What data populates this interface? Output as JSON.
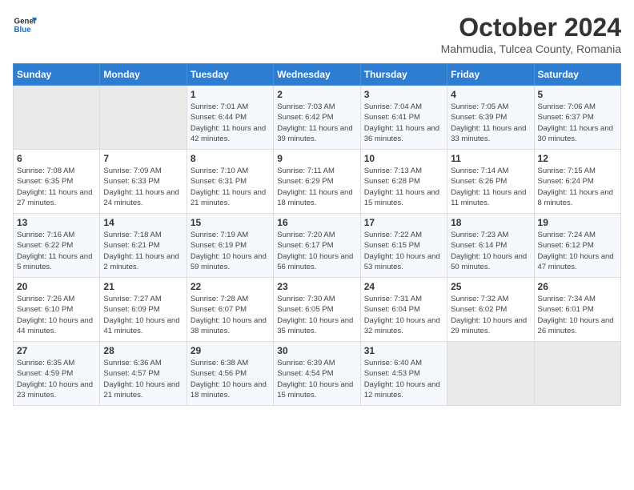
{
  "header": {
    "logo_line1": "General",
    "logo_line2": "Blue",
    "title": "October 2024",
    "subtitle": "Mahmudia, Tulcea County, Romania"
  },
  "weekdays": [
    "Sunday",
    "Monday",
    "Tuesday",
    "Wednesday",
    "Thursday",
    "Friday",
    "Saturday"
  ],
  "weeks": [
    [
      {
        "num": "",
        "info": ""
      },
      {
        "num": "",
        "info": ""
      },
      {
        "num": "1",
        "info": "Sunrise: 7:01 AM\nSunset: 6:44 PM\nDaylight: 11 hours and 42 minutes."
      },
      {
        "num": "2",
        "info": "Sunrise: 7:03 AM\nSunset: 6:42 PM\nDaylight: 11 hours and 39 minutes."
      },
      {
        "num": "3",
        "info": "Sunrise: 7:04 AM\nSunset: 6:41 PM\nDaylight: 11 hours and 36 minutes."
      },
      {
        "num": "4",
        "info": "Sunrise: 7:05 AM\nSunset: 6:39 PM\nDaylight: 11 hours and 33 minutes."
      },
      {
        "num": "5",
        "info": "Sunrise: 7:06 AM\nSunset: 6:37 PM\nDaylight: 11 hours and 30 minutes."
      }
    ],
    [
      {
        "num": "6",
        "info": "Sunrise: 7:08 AM\nSunset: 6:35 PM\nDaylight: 11 hours and 27 minutes."
      },
      {
        "num": "7",
        "info": "Sunrise: 7:09 AM\nSunset: 6:33 PM\nDaylight: 11 hours and 24 minutes."
      },
      {
        "num": "8",
        "info": "Sunrise: 7:10 AM\nSunset: 6:31 PM\nDaylight: 11 hours and 21 minutes."
      },
      {
        "num": "9",
        "info": "Sunrise: 7:11 AM\nSunset: 6:29 PM\nDaylight: 11 hours and 18 minutes."
      },
      {
        "num": "10",
        "info": "Sunrise: 7:13 AM\nSunset: 6:28 PM\nDaylight: 11 hours and 15 minutes."
      },
      {
        "num": "11",
        "info": "Sunrise: 7:14 AM\nSunset: 6:26 PM\nDaylight: 11 hours and 11 minutes."
      },
      {
        "num": "12",
        "info": "Sunrise: 7:15 AM\nSunset: 6:24 PM\nDaylight: 11 hours and 8 minutes."
      }
    ],
    [
      {
        "num": "13",
        "info": "Sunrise: 7:16 AM\nSunset: 6:22 PM\nDaylight: 11 hours and 5 minutes."
      },
      {
        "num": "14",
        "info": "Sunrise: 7:18 AM\nSunset: 6:21 PM\nDaylight: 11 hours and 2 minutes."
      },
      {
        "num": "15",
        "info": "Sunrise: 7:19 AM\nSunset: 6:19 PM\nDaylight: 10 hours and 59 minutes."
      },
      {
        "num": "16",
        "info": "Sunrise: 7:20 AM\nSunset: 6:17 PM\nDaylight: 10 hours and 56 minutes."
      },
      {
        "num": "17",
        "info": "Sunrise: 7:22 AM\nSunset: 6:15 PM\nDaylight: 10 hours and 53 minutes."
      },
      {
        "num": "18",
        "info": "Sunrise: 7:23 AM\nSunset: 6:14 PM\nDaylight: 10 hours and 50 minutes."
      },
      {
        "num": "19",
        "info": "Sunrise: 7:24 AM\nSunset: 6:12 PM\nDaylight: 10 hours and 47 minutes."
      }
    ],
    [
      {
        "num": "20",
        "info": "Sunrise: 7:26 AM\nSunset: 6:10 PM\nDaylight: 10 hours and 44 minutes."
      },
      {
        "num": "21",
        "info": "Sunrise: 7:27 AM\nSunset: 6:09 PM\nDaylight: 10 hours and 41 minutes."
      },
      {
        "num": "22",
        "info": "Sunrise: 7:28 AM\nSunset: 6:07 PM\nDaylight: 10 hours and 38 minutes."
      },
      {
        "num": "23",
        "info": "Sunrise: 7:30 AM\nSunset: 6:05 PM\nDaylight: 10 hours and 35 minutes."
      },
      {
        "num": "24",
        "info": "Sunrise: 7:31 AM\nSunset: 6:04 PM\nDaylight: 10 hours and 32 minutes."
      },
      {
        "num": "25",
        "info": "Sunrise: 7:32 AM\nSunset: 6:02 PM\nDaylight: 10 hours and 29 minutes."
      },
      {
        "num": "26",
        "info": "Sunrise: 7:34 AM\nSunset: 6:01 PM\nDaylight: 10 hours and 26 minutes."
      }
    ],
    [
      {
        "num": "27",
        "info": "Sunrise: 6:35 AM\nSunset: 4:59 PM\nDaylight: 10 hours and 23 minutes."
      },
      {
        "num": "28",
        "info": "Sunrise: 6:36 AM\nSunset: 4:57 PM\nDaylight: 10 hours and 21 minutes."
      },
      {
        "num": "29",
        "info": "Sunrise: 6:38 AM\nSunset: 4:56 PM\nDaylight: 10 hours and 18 minutes."
      },
      {
        "num": "30",
        "info": "Sunrise: 6:39 AM\nSunset: 4:54 PM\nDaylight: 10 hours and 15 minutes."
      },
      {
        "num": "31",
        "info": "Sunrise: 6:40 AM\nSunset: 4:53 PM\nDaylight: 10 hours and 12 minutes."
      },
      {
        "num": "",
        "info": ""
      },
      {
        "num": "",
        "info": ""
      }
    ]
  ]
}
